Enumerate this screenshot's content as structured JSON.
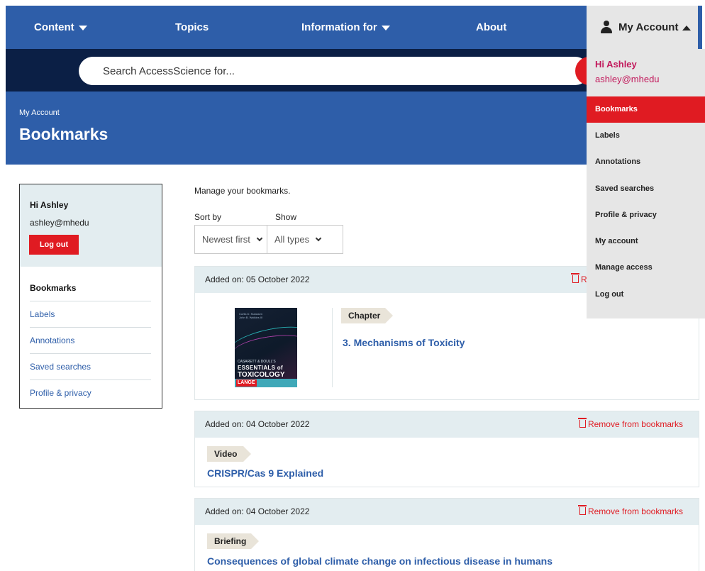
{
  "nav": {
    "content": "Content",
    "topics": "Topics",
    "information_for": "Information for",
    "about": "About",
    "my_account": "My Account"
  },
  "search": {
    "placeholder": "Search AccessScience for..."
  },
  "header": {
    "breadcrumb": "My Account",
    "title": "Bookmarks"
  },
  "sidebar": {
    "greeting": "Hi Ashley",
    "email": "ashley@mhedu",
    "logout": "Log out",
    "items": [
      "Bookmarks",
      "Labels",
      "Annotations",
      "Saved searches",
      "Profile & privacy"
    ]
  },
  "main": {
    "intro": "Manage your bookmarks.",
    "sort_label": "Sort by",
    "sort_value": "Newest first",
    "show_label": "Show",
    "show_value": "All types",
    "remove_label": "Remove from bookmarks",
    "bookmarks": [
      {
        "added": "Added on: 05 October 2022",
        "type": "Chapter",
        "title": "3. Mechanisms of Toxicity",
        "remove_visible": "R",
        "cover": {
          "authors": "Curtis D. Klaassen\nJohn B. Watkins III",
          "line1": "CASARETT & DOULL'S",
          "line2": "ESSENTIALS of",
          "line3": "TOXICOLOGY",
          "imprint": "LANGE"
        }
      },
      {
        "added": "Added on: 04 October 2022",
        "type": "Video",
        "title": "CRISPR/Cas 9 Explained"
      },
      {
        "added": "Added on: 04 October 2022",
        "type": "Briefing",
        "title": "Consequences of global climate change on infectious disease in humans"
      }
    ]
  },
  "account_menu": {
    "greeting": "Hi Ashley",
    "email": "ashley@mhedu",
    "items": [
      "Bookmarks",
      "Labels",
      "Annotations",
      "Saved searches",
      "Profile & privacy",
      "My account",
      "Manage access",
      "Log out"
    ],
    "active": "Bookmarks"
  },
  "colors": {
    "primary_blue": "#2e5ea9",
    "navy": "#0b1f45",
    "accent_red": "#e01b22",
    "panel_gray": "#e3edf0",
    "tag_beige": "#e9e4d9"
  }
}
